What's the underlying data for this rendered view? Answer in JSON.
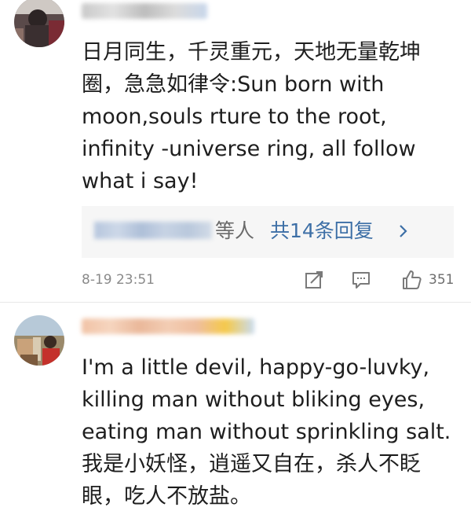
{
  "comments": [
    {
      "text": "日月同生，千灵重元，天地无量乾坤圈，急急如律令:Sun born with moon,souls rture to the root, infinity -universe ring, all follow what i say!",
      "replies": {
        "suffix": "等人",
        "count_label": "共14条回复"
      },
      "timestamp": "8-19 23:51",
      "likes": "351"
    },
    {
      "text": "I'm a little devil, happy-go-luvky, killing man without bliking eyes, eating man without sprinkling salt. 我是小妖怪，逍遥又自在，杀人不眨眼，吃人不放盐。"
    }
  ],
  "colors": {
    "link": "#3d6fa6",
    "meta": "#8a8a8a",
    "reply_bg": "#f6f6f6"
  },
  "icons": {
    "share": "share-icon",
    "comment": "comment-icon",
    "like": "thumbs-up-icon",
    "chevron": "chevron-right-icon"
  }
}
